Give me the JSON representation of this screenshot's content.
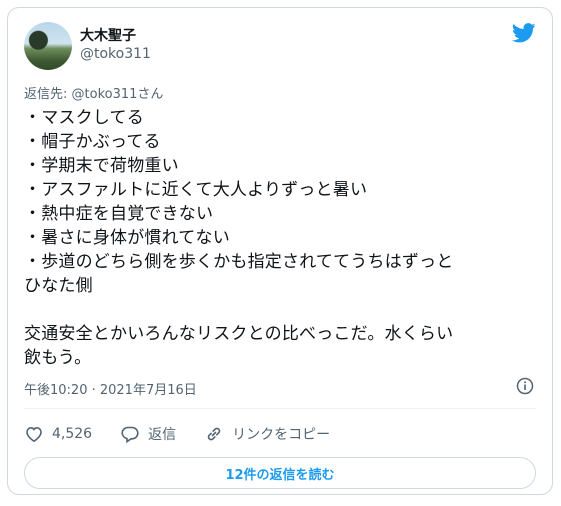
{
  "author": {
    "name": "大木聖子",
    "handle": "@toko311"
  },
  "reply_to": "返信先: @toko311さん",
  "tweet_text": "・マスクしてる\n・帽子かぶってる\n・学期末で荷物重い\n・アスファルトに近くて大人よりずっと暑い\n・熱中症を自覚できない\n・暑さに身体が慣れてない\n・歩道のどちら側を歩くかも指定されててうちはずっと\nひなた側\n\n交通安全とかいろんなリスクとの比べっこだ。水くらい\n飲もう。",
  "timestamp": "午後10:20 · 2021年7月16日",
  "actions": {
    "like_count": "4,526",
    "reply_label": "返信",
    "copy_link_label": "リンクをコピー"
  },
  "read_replies_label": "12件の返信を読む",
  "colors": {
    "accent": "#1d9bf0",
    "secondary_text": "#536471",
    "border": "#cfd9de"
  },
  "icons": [
    "twitter-bird-icon",
    "info-icon",
    "heart-icon",
    "reply-icon",
    "link-icon"
  ]
}
